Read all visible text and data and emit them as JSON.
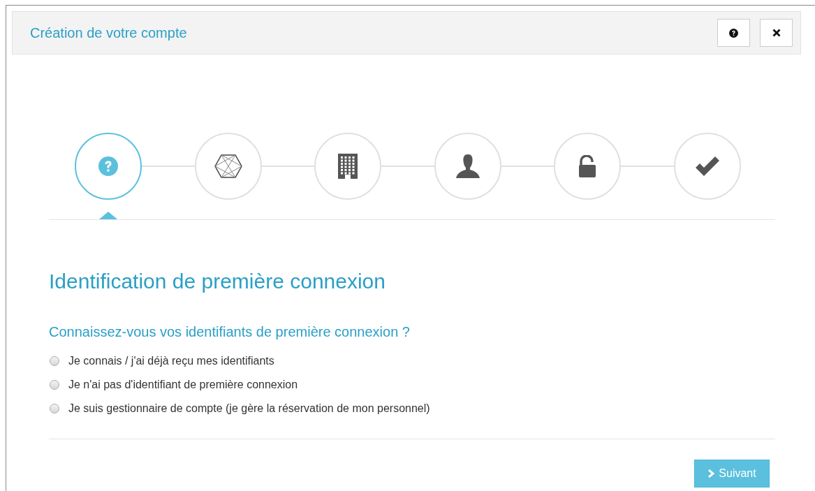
{
  "dialog": {
    "title": "Création de votre compte"
  },
  "header_buttons": [
    {
      "kind": "help"
    },
    {
      "kind": "close"
    }
  ],
  "steps": [
    {
      "kind": "question",
      "selected": true
    },
    {
      "kind": "hexagon",
      "selected": false
    },
    {
      "kind": "building",
      "selected": false
    },
    {
      "kind": "user",
      "selected": false
    },
    {
      "kind": "unlock",
      "selected": false
    },
    {
      "kind": "check",
      "selected": false
    }
  ],
  "heading": "Identification de première connexion",
  "question": "Connaissez-vous vos identifiants de première connexion ?",
  "options": [
    {
      "label": "Je connais / j'ai déjà reçu mes identifiants",
      "selected": false
    },
    {
      "label": "Je n'ai pas d'identifiant de première connexion",
      "selected": false
    },
    {
      "label": "Je suis gestionnaire de compte (je gère la réservation de mon personnel)",
      "selected": false
    }
  ],
  "next_button": {
    "label": "Suivant"
  }
}
